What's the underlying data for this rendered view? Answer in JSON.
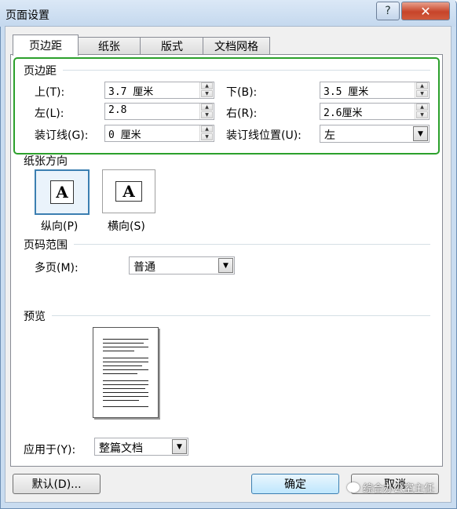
{
  "window": {
    "title": "页面设置",
    "help_label": "?",
    "close_label": "✕"
  },
  "tabs": [
    {
      "label": "页边距",
      "active": true
    },
    {
      "label": "纸张",
      "active": false
    },
    {
      "label": "版式",
      "active": false
    },
    {
      "label": "文档网格",
      "active": false
    }
  ],
  "margins": {
    "group_label": "页边距",
    "top": {
      "label": "上(T):",
      "value": "3.7 厘米"
    },
    "bottom": {
      "label": "下(B):",
      "value": "3.5 厘米"
    },
    "left": {
      "label": "左(L):",
      "value": "2.8"
    },
    "right": {
      "label": "右(R):",
      "value": "2.6厘米"
    },
    "gutter": {
      "label": "装订线(G):",
      "value": "0 厘米"
    },
    "gutter_pos": {
      "label": "装订线位置(U):",
      "value": "左"
    }
  },
  "orientation": {
    "group_label": "纸张方向",
    "portrait": {
      "label": "纵向(P)",
      "glyph": "A",
      "selected": true
    },
    "landscape": {
      "label": "横向(S)",
      "glyph": "A",
      "selected": false
    }
  },
  "pages": {
    "group_label": "页码范围",
    "multiple_label": "多页(M):",
    "multiple_value": "普通"
  },
  "preview": {
    "group_label": "预览"
  },
  "apply": {
    "label": "应用于(Y):",
    "value": "整篇文档"
  },
  "buttons": {
    "default_label": "默认(D)...",
    "ok_label": "确定",
    "cancel_label": "取消"
  },
  "watermark": {
    "text": "综合办公室主任"
  },
  "colors": {
    "highlight": "#2ca02c",
    "close": "#c7442a",
    "accent": "#3c7fb1"
  }
}
